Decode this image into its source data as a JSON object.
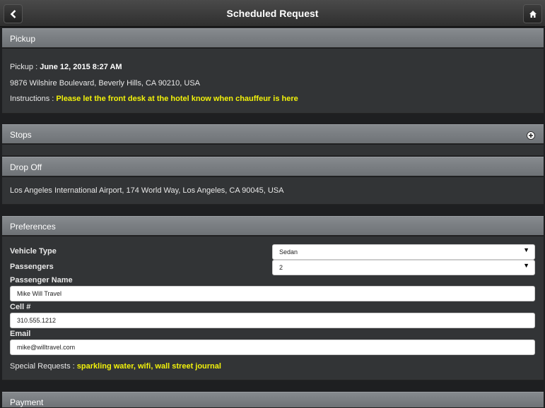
{
  "header": {
    "title": "Scheduled Request"
  },
  "pickup": {
    "section_title": "Pickup",
    "pickup_label": "Pickup :",
    "pickup_datetime": "June 12, 2015 8:27 AM",
    "address": "9876 Wilshire Boulevard, Beverly Hills, CA 90210, USA",
    "instructions_label": "Instructions :",
    "instructions": "Please let the front desk at the hotel know when chauffeur is here"
  },
  "stops": {
    "section_title": "Stops"
  },
  "dropoff": {
    "section_title": "Drop Off",
    "address": "Los Angeles International Airport, 174 World Way, Los Angeles, CA 90045, USA"
  },
  "preferences": {
    "section_title": "Preferences",
    "vehicle_type_label": "Vehicle Type",
    "vehicle_type": "Sedan",
    "passengers_label": "Passengers",
    "passengers": "2",
    "passenger_name_label": "Passenger Name",
    "passenger_name": "Mike Will Travel",
    "cell_label": "Cell #",
    "cell": "310.555.1212",
    "email_label": "Email",
    "email": "mike@willtravel.com",
    "special_requests_label": "Special Requests :",
    "special_requests": "sparkling water, wifi, wall street journal"
  },
  "payment": {
    "section_title": "Payment"
  },
  "colors": {
    "accent_yellow": "#f2f20a",
    "header_gray": "#7a7e82",
    "body_dark": "#323436"
  },
  "icons": {
    "back": "chevron-left-icon",
    "home": "home-icon",
    "add_stop": "plus-circle-icon"
  }
}
